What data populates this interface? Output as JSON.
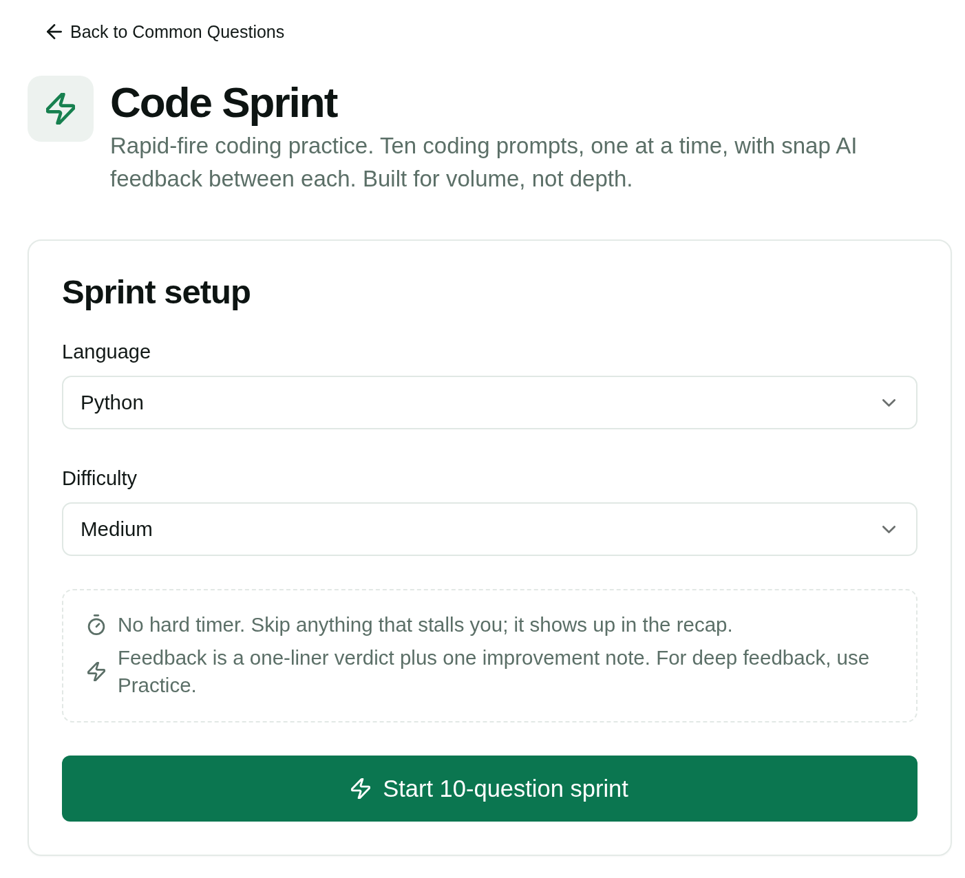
{
  "back_link": {
    "label": "Back to Common Questions"
  },
  "header": {
    "title": "Code Sprint",
    "description": "Rapid-fire coding practice. Ten coding prompts, one at a time, with snap AI feedback between each. Built for volume, not depth."
  },
  "setup": {
    "title": "Sprint setup",
    "fields": [
      {
        "label": "Language",
        "value": "Python"
      },
      {
        "label": "Difficulty",
        "value": "Medium"
      }
    ],
    "notes": [
      {
        "kind": "timer",
        "text": "No hard timer. Skip anything that stalls you; it shows up in the recap."
      },
      {
        "kind": "bolt",
        "text": "Feedback is a one-liner verdict plus one improvement note. For deep feedback, use Practice."
      }
    ],
    "start_button": {
      "label": "Start 10-question sprint"
    }
  }
}
